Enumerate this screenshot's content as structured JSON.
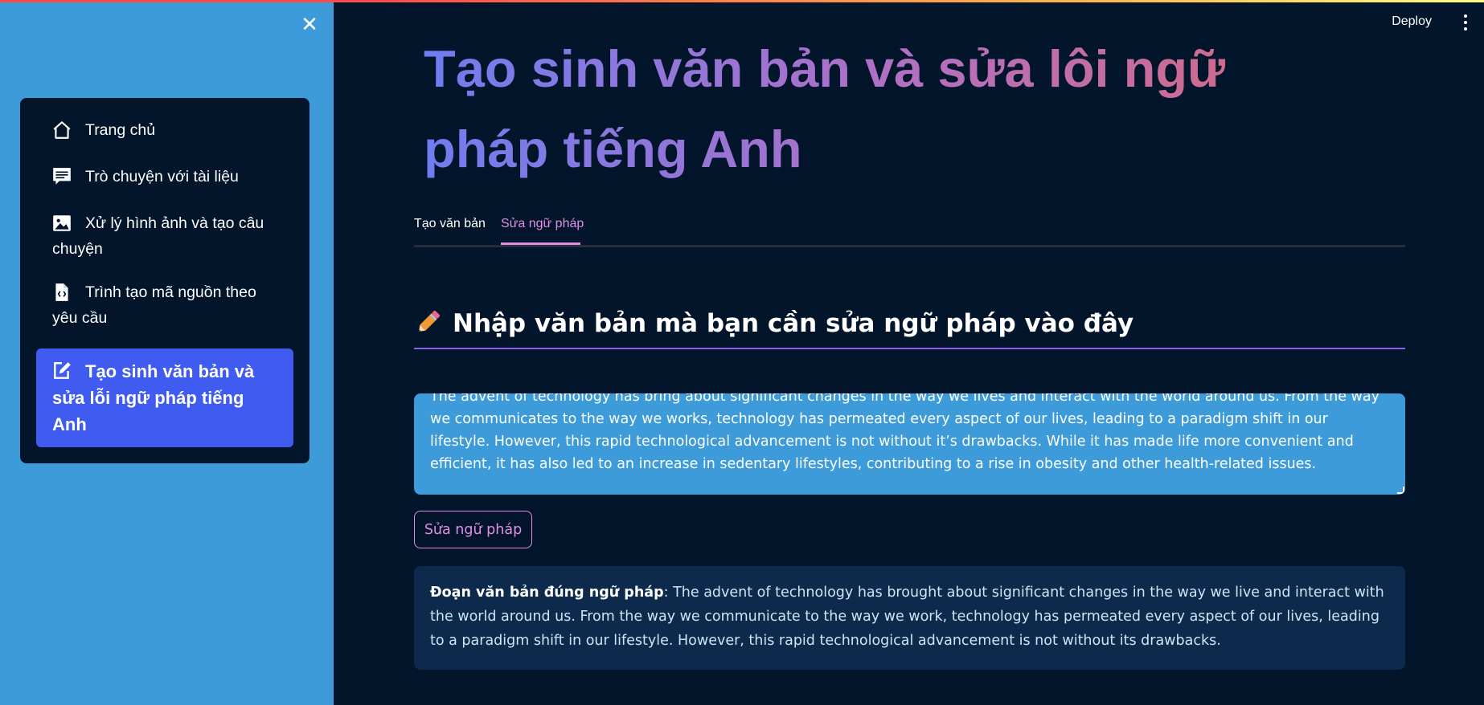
{
  "sidebar": {
    "close_label": "✕",
    "items": [
      {
        "label": "Trang chủ",
        "icon": "home-icon"
      },
      {
        "label": "Trò chuyện với tài liệu",
        "icon": "chat-icon"
      },
      {
        "label": "Xử lý hình ảnh và tạo câu chuyện",
        "icon": "image-icon"
      },
      {
        "label": "Trình tạo mã nguồn theo yêu cầu",
        "icon": "code-file-icon"
      },
      {
        "label": "Tạo sinh văn bản và sửa lỗi ngữ pháp tiếng Anh",
        "icon": "edit-icon",
        "active": true
      }
    ]
  },
  "header": {
    "deploy_label": "Deploy",
    "menu_icon": "kebab-menu-icon"
  },
  "main": {
    "title": "Tạo sinh văn bản và sửa lôi ngữ pháp tiếng Anh",
    "tabs": [
      {
        "label": "Tạo văn bản"
      },
      {
        "label": "Sửa ngữ pháp",
        "active": true
      }
    ],
    "section_heading": "Nhập văn bản mà bạn cần sửa ngữ pháp vào đây",
    "input_text": "The advent of technology has bring about significant changes in the way we lives and interact with the world around us. From the way we communicates to the way we works, technology has permeated every aspect of our lives, leading to a paradigm shift in our lifestyle. However, this rapid technological advancement is not without it’s drawbacks. While it has made life more convenient and efficient, it has also led to an increase in sedentary lifestyles, contributing to a rise in obesity and other health-related issues.",
    "button_label": "Sửa ngữ pháp",
    "result_label": "Đoạn văn bản đúng ngữ pháp",
    "result_text": ": The advent of technology has brought about significant changes in the way we live and interact with the world around us. From the way we communicate to the way we work, technology has permeated every aspect of our lives, leading to a paradigm shift in our lifestyle. However, this rapid technological advancement is not without its drawbacks."
  },
  "colors": {
    "sidebar_bg": "#3d9bd9",
    "main_bg": "#02152b",
    "active_nav": "#3f5bf0",
    "accent": "#e28ee6"
  }
}
